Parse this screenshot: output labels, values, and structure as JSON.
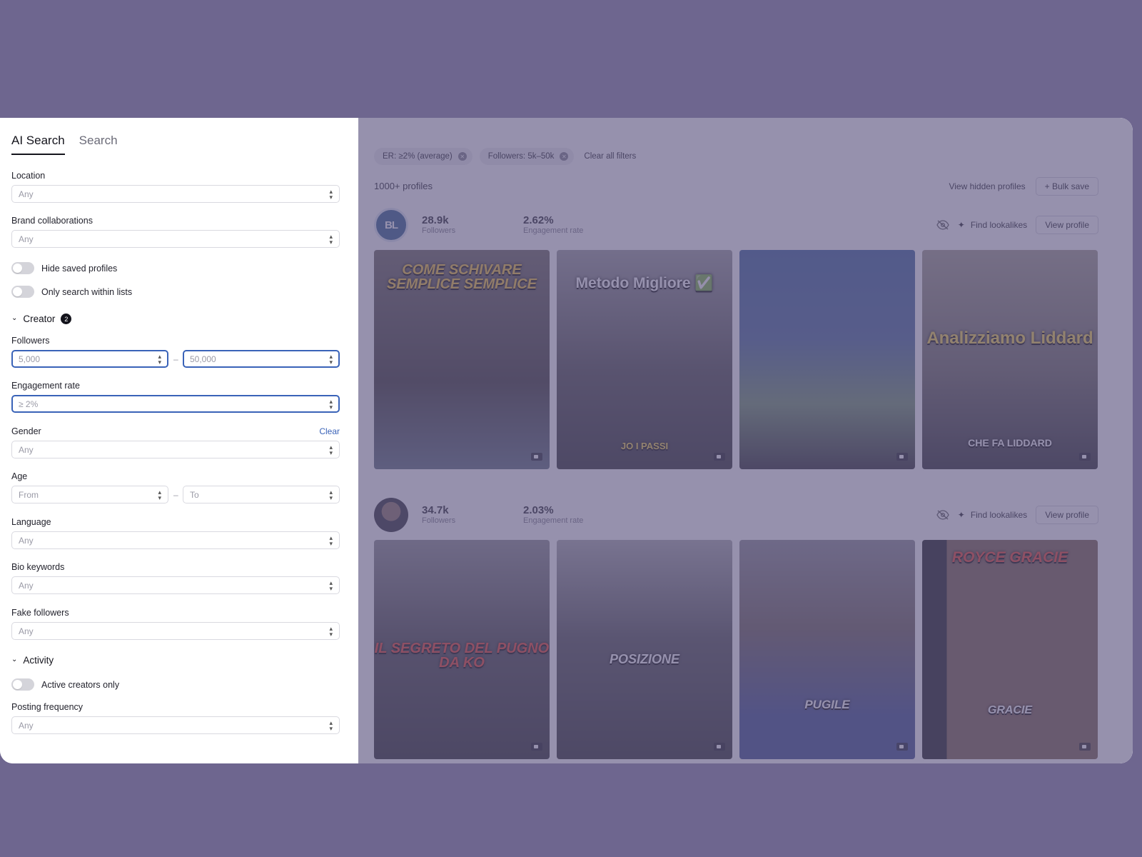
{
  "tabs": [
    {
      "label": "AI Search",
      "active": true
    },
    {
      "label": "Search",
      "active": false
    }
  ],
  "filters": {
    "location": {
      "label": "Location",
      "value": "Any"
    },
    "brand_collaborations": {
      "label": "Brand collaborations",
      "value": "Any"
    },
    "hide_saved": {
      "label": "Hide saved profiles",
      "on": false
    },
    "only_lists": {
      "label": "Only search within lists",
      "on": false
    },
    "creator_section": {
      "label": "Creator",
      "badge": "2"
    },
    "followers": {
      "label": "Followers",
      "from": "5,000",
      "to": "50,000"
    },
    "engagement": {
      "label": "Engagement rate",
      "value": "≥ 2%"
    },
    "gender": {
      "label": "Gender",
      "value": "Any",
      "clear": "Clear"
    },
    "age": {
      "label": "Age",
      "from": "From",
      "to": "To"
    },
    "language": {
      "label": "Language",
      "value": "Any"
    },
    "bio_keywords": {
      "label": "Bio keywords",
      "value": "Any"
    },
    "fake_followers": {
      "label": "Fake followers",
      "value": "Any"
    },
    "activity_section": {
      "label": "Activity"
    },
    "active_only": {
      "label": "Active creators only",
      "on": false
    },
    "posting_frequency": {
      "label": "Posting frequency",
      "value": "Any"
    }
  },
  "chips": [
    {
      "label": "ER: ≥2% (average)"
    },
    {
      "label": "Followers: 5k–50k"
    }
  ],
  "clear_all": "Clear all filters",
  "results_count": "1000+ profiles",
  "view_hidden": "View hidden profiles",
  "bulk_save": "+ Bulk save",
  "profiles": [
    {
      "avatar_text": "BL",
      "followers": "28.9k",
      "followers_label": "Followers",
      "engagement": "2.62%",
      "engagement_label": "Engagement rate",
      "find_lookalikes": "Find lookalikes",
      "view_profile": "View profile",
      "posts": [
        {
          "caption": "COME SCHIVARE SEMPLICE SEMPLICE",
          "bg": "#4a4541",
          "cap_color": "#f0c23a"
        },
        {
          "caption": "Metodo Migliore ✅",
          "bg": "#5e5b58",
          "cap_color": "#ffffff",
          "sub": "JO I PASSI"
        },
        {
          "caption": "",
          "bg": "#3f5a86"
        },
        {
          "caption": "Analizziamo Liddard",
          "bg": "#7d7a72",
          "cap_color": "#f4d24a",
          "sub": "CHE FA LIDDARD"
        }
      ]
    },
    {
      "avatar_text": "",
      "followers": "34.7k",
      "followers_label": "Followers",
      "engagement": "2.03%",
      "engagement_label": "Engagement rate",
      "find_lookalikes": "Find lookalikes",
      "view_profile": "View profile",
      "posts": [
        {
          "caption": "IL SEGRETO DEL PUGNO DA KO",
          "bg": "#3b3a3c",
          "cap_color": "#e8402a"
        },
        {
          "caption": "POSIZIONE",
          "bg": "#4a4a4c",
          "cap_color": "#ffffff"
        },
        {
          "caption": "PUGILE",
          "bg": "#50505a",
          "cap_color": "#ffffff"
        },
        {
          "caption": "ROYCE GRACIE",
          "bg": "#6b5a4a",
          "cap_color": "#e8402a",
          "sub": "GRACIE"
        }
      ]
    }
  ]
}
